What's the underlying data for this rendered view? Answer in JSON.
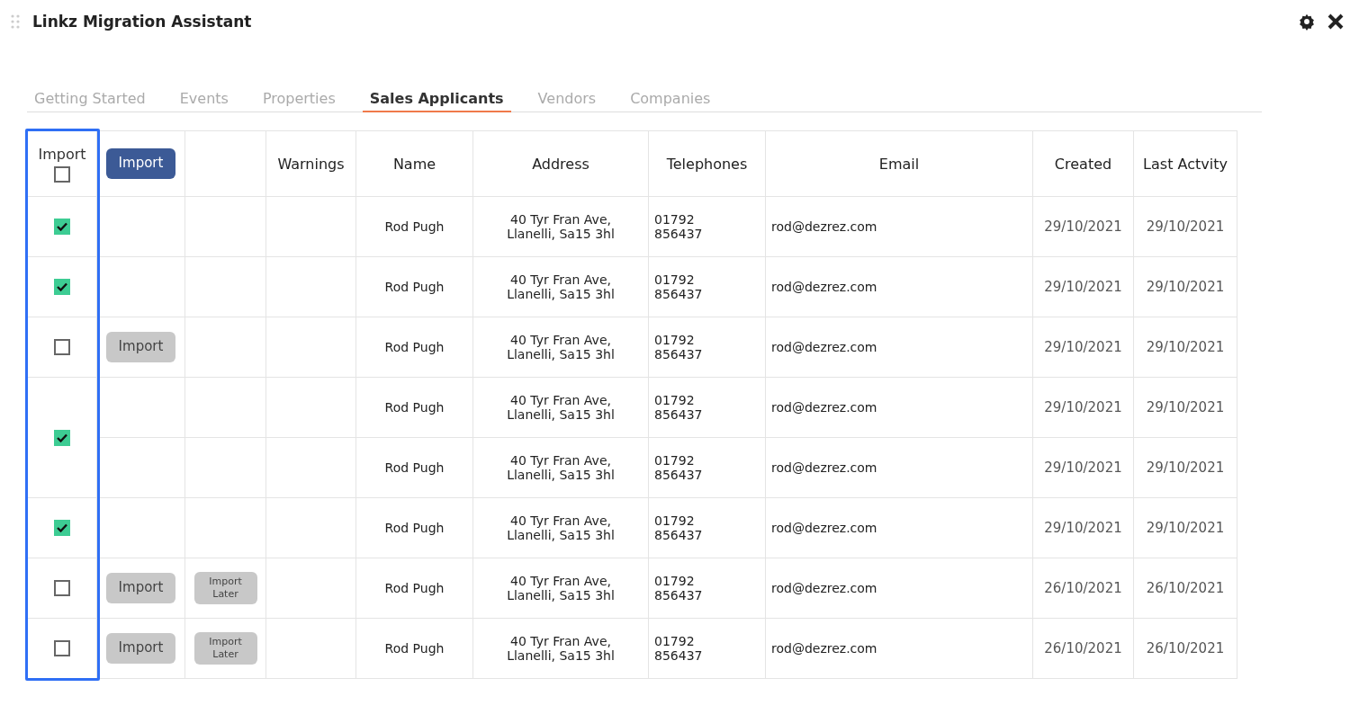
{
  "window": {
    "title": "Linkz Migration Assistant"
  },
  "tabs": [
    {
      "label": "Getting Started",
      "selected": false
    },
    {
      "label": "Events",
      "selected": false
    },
    {
      "label": "Properties",
      "selected": false
    },
    {
      "label": "Sales Applicants",
      "selected": true
    },
    {
      "label": "Vendors",
      "selected": false
    },
    {
      "label": "Companies",
      "selected": false
    }
  ],
  "table": {
    "import_column_highlighted": true,
    "header": {
      "import_label": "Import",
      "all_checked": false,
      "import_button": "Import"
    },
    "columns": [
      "Warnings",
      "Name",
      "Address",
      "Telephones",
      "Email",
      "Created",
      "Last Actvity"
    ],
    "rows": [
      {
        "checked": true,
        "import_button": "",
        "import_later_button": "",
        "warnings": "",
        "name": "Rod Pugh",
        "address": "40 Tyr Fran Ave, Llanelli, Sa15 3hl",
        "telephone": "01792 856437",
        "email": "rod@dezrez.com",
        "created": "29/10/2021",
        "last_activity": "29/10/2021"
      },
      {
        "checked": true,
        "import_button": "",
        "import_later_button": "",
        "warnings": "",
        "name": "Rod Pugh",
        "address": "40 Tyr Fran Ave, Llanelli, Sa15 3hl",
        "telephone": "01792 856437",
        "email": "rod@dezrez.com",
        "created": "29/10/2021",
        "last_activity": "29/10/2021"
      },
      {
        "checked": false,
        "import_button": "Import",
        "import_later_button": "",
        "warnings": "",
        "name": "Rod Pugh",
        "address": "40 Tyr Fran Ave, Llanelli, Sa15 3hl",
        "telephone": "01792 856437",
        "email": "rod@dezrez.com",
        "created": "29/10/2021",
        "last_activity": "29/10/2021"
      },
      {
        "checked": true,
        "import_button": "",
        "import_later_button": "",
        "warnings": "",
        "name": "Rod Pugh",
        "address": "40 Tyr Fran Ave, Llanelli, Sa15 3hl",
        "telephone": "01792 856437",
        "email": "rod@dezrez.com",
        "created": "29/10/2021",
        "last_activity": "29/10/2021"
      },
      {
        "import_button": "",
        "import_later_button": "",
        "warnings": "",
        "name": "Rod Pugh",
        "address": "40 Tyr Fran Ave, Llanelli, Sa15 3hl",
        "telephone": "01792 856437",
        "email": "rod@dezrez.com",
        "created": "29/10/2021",
        "last_activity": "29/10/2021"
      },
      {
        "checked": true,
        "import_button": "",
        "import_later_button": "",
        "warnings": "",
        "name": "Rod Pugh",
        "address": "40 Tyr Fran Ave, Llanelli, Sa15 3hl",
        "telephone": "01792 856437",
        "email": "rod@dezrez.com",
        "created": "29/10/2021",
        "last_activity": "29/10/2021"
      },
      {
        "checked": false,
        "import_button": "Import",
        "import_later_button": "Import Later",
        "warnings": "",
        "name": "Rod Pugh",
        "address": "40 Tyr Fran Ave, Llanelli, Sa15 3hl",
        "telephone": "01792 856437",
        "email": "rod@dezrez.com",
        "created": "26/10/2021",
        "last_activity": "26/10/2021"
      },
      {
        "checked": false,
        "import_button": "Import",
        "import_later_button": "Import Later",
        "warnings": "",
        "name": "Rod Pugh",
        "address": "40 Tyr Fran Ave, Llanelli, Sa15 3hl",
        "telephone": "01792 856437",
        "email": "rod@dezrez.com",
        "created": "26/10/2021",
        "last_activity": "26/10/2021"
      }
    ]
  }
}
